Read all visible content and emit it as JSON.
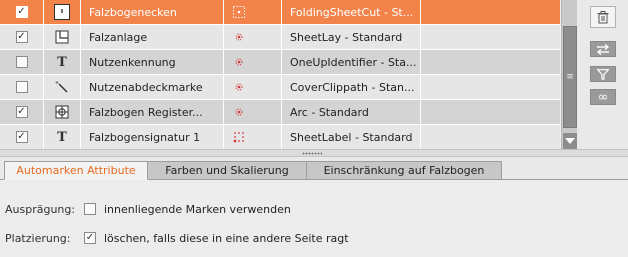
{
  "table": {
    "rows": [
      {
        "checked": true,
        "icon": "ticket-icon",
        "name": "Falzbogenecken",
        "mark_icon": "dotted-square-icon",
        "template": "FoldingSheetCut - St..."
      },
      {
        "checked": true,
        "icon": "corner-layout-icon",
        "name": "Falzanlage",
        "mark_icon": "crosshair-dot-icon",
        "template": "SheetLay - Standard"
      },
      {
        "checked": false,
        "icon": "text-t-icon",
        "name": "Nutzenkennung",
        "mark_icon": "crosshair-dot-icon",
        "template": "OneUpIdentifier - Sta..."
      },
      {
        "checked": false,
        "icon": "magic-wand-icon",
        "name": "Nutzenabdeckmarke",
        "mark_icon": "crosshair-dot-icon",
        "template": "CoverClippath - Stan..."
      },
      {
        "checked": true,
        "icon": "register-mark-icon",
        "name": "Falzbogen Register...",
        "mark_icon": "crosshair-dot-icon",
        "template": "Arc - Standard"
      },
      {
        "checked": true,
        "icon": "text-t-icon",
        "name": "Falzbogensignatur 1",
        "mark_icon": "dotted-grid-icon",
        "template": "SheetLabel - Standard"
      }
    ],
    "check_glyph": "✓",
    "text_glyph": "T"
  },
  "tools": [
    {
      "name": "trash-icon"
    },
    {
      "name": "swap-arrows-icon"
    },
    {
      "name": "filter-icon"
    },
    {
      "name": "infinity-icon",
      "glyph": "∞"
    }
  ],
  "tabs": [
    {
      "label": "Automarken Attribute",
      "active": true
    },
    {
      "label": "Farben und Skalierung",
      "active": false
    },
    {
      "label": "Einschränkung auf Falzbogen",
      "active": false
    }
  ],
  "options": {
    "auspraegung": {
      "label": "Ausprägung:",
      "checked": false,
      "text": "innenliegende Marken verwenden"
    },
    "platzierung": {
      "label": "Platzierung:",
      "checked": true,
      "text": "löschen, falls diese in eine andere Seite ragt"
    }
  },
  "colors": {
    "selected_row": "#f2844b",
    "active_tab_text": "#e36a20",
    "mark_red": "#d43a3a"
  }
}
